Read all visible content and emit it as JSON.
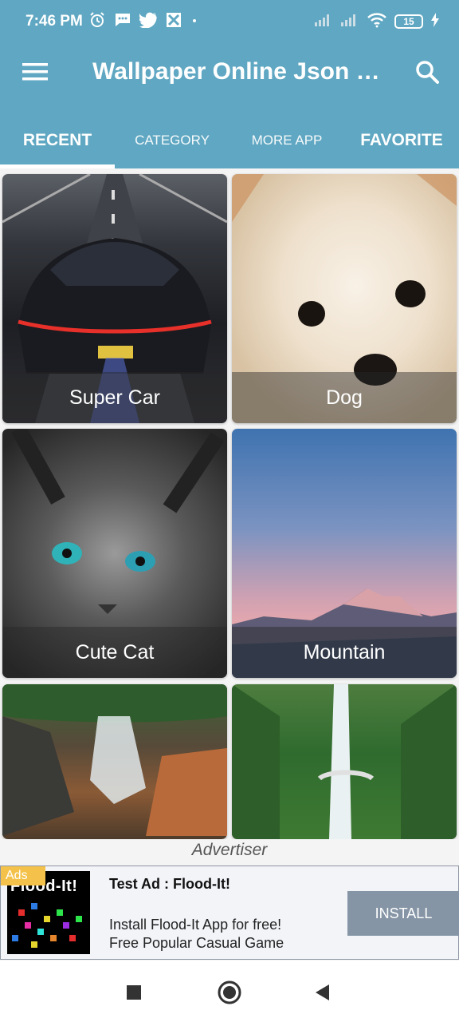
{
  "status_bar": {
    "time": "7:46 PM",
    "battery": "15",
    "icons": [
      "alarm-icon",
      "message-icon",
      "twitter-icon",
      "app-icon",
      "dot-icon",
      "signal-icon",
      "signal-icon",
      "wifi-icon",
      "battery-icon",
      "charging-icon"
    ]
  },
  "toolbar": {
    "title": "Wallpaper Online Json V...",
    "menu_icon": "hamburger-menu-icon",
    "search_icon": "search-icon"
  },
  "tabs": [
    {
      "label": "RECENT",
      "active": true
    },
    {
      "label": "CATEGORY",
      "active": false
    },
    {
      "label": "MORE APP",
      "active": false
    },
    {
      "label": "FAVORITE",
      "active": false
    }
  ],
  "wallpapers": [
    {
      "label": "Super Car"
    },
    {
      "label": "Dog"
    },
    {
      "label": "Cute Cat"
    },
    {
      "label": "Mountain"
    },
    {
      "label": ""
    },
    {
      "label": ""
    }
  ],
  "ad": {
    "heading": "Advertiser",
    "badge": "Ads",
    "logo_text": "Flood-It!",
    "title": "Test Ad : Flood-It!",
    "description_line1": "Install Flood-It App for free!",
    "description_line2": "Free Popular Casual Game",
    "install_label": "INSTALL"
  },
  "nav_bar": {
    "icons": [
      "recents-square-icon",
      "home-circle-icon",
      "back-triangle-icon"
    ]
  },
  "colors": {
    "primary": "#5fa7c2",
    "ad_button": "#8695a6",
    "ad_badge": "#f4c24a"
  }
}
